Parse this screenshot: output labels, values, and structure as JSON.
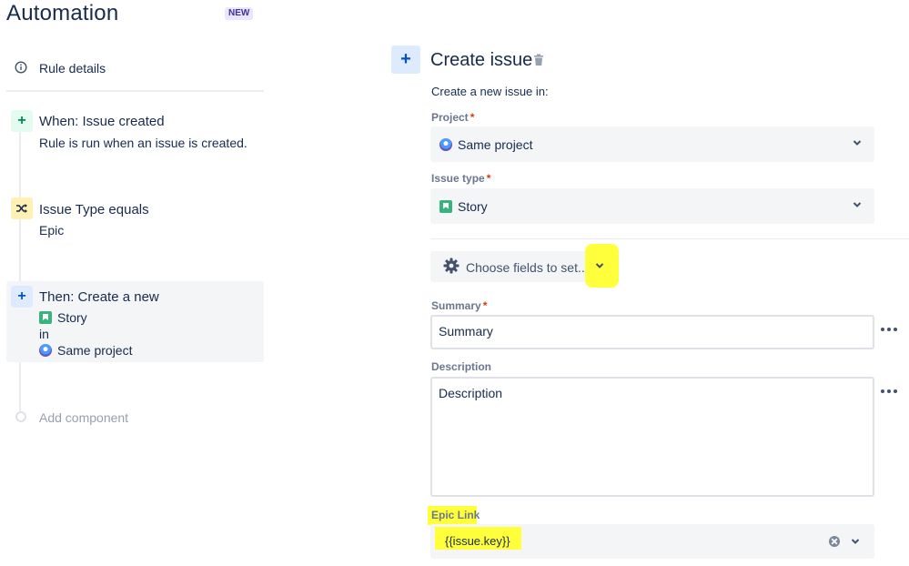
{
  "header": {
    "title": "Automation",
    "badge": "NEW"
  },
  "sidebar": {
    "rule_details": "Rule details",
    "steps": [
      {
        "title": "When: Issue created",
        "subtitle": "Rule is run when an issue is created."
      },
      {
        "title": "Issue Type equals",
        "subtitle": "Epic"
      },
      {
        "title": "Then: Create a new",
        "line1": "Story",
        "line2": "in",
        "line3": "Same project"
      }
    ],
    "add_component": "Add component"
  },
  "panel": {
    "title": "Create issue",
    "subtitle": "Create a new issue in:",
    "project": {
      "label": "Project",
      "required": "*",
      "value": "Same project"
    },
    "issue_type": {
      "label": "Issue type",
      "required": "*",
      "value": "Story"
    },
    "choose_fields": "Choose fields to set...",
    "summary": {
      "label": "Summary",
      "required": "*",
      "value": "Summary"
    },
    "description": {
      "label": "Description",
      "value": "Description"
    },
    "epic_link": {
      "label": "Epic Link",
      "value": "{{issue.key}}"
    }
  },
  "colors": {
    "highlight": "#ffff3c",
    "trigger_green": "#00875a",
    "action_blue": "#0052cc",
    "condition_yellow": "#fff0b3",
    "story_green": "#36b37e",
    "required_red": "#de350b"
  },
  "icons": [
    "info-icon",
    "plus-icon",
    "shuffle-icon",
    "story-icon",
    "project-icon",
    "trash-icon",
    "chevron-down-icon",
    "gear-icon",
    "more-icon",
    "clear-icon"
  ]
}
